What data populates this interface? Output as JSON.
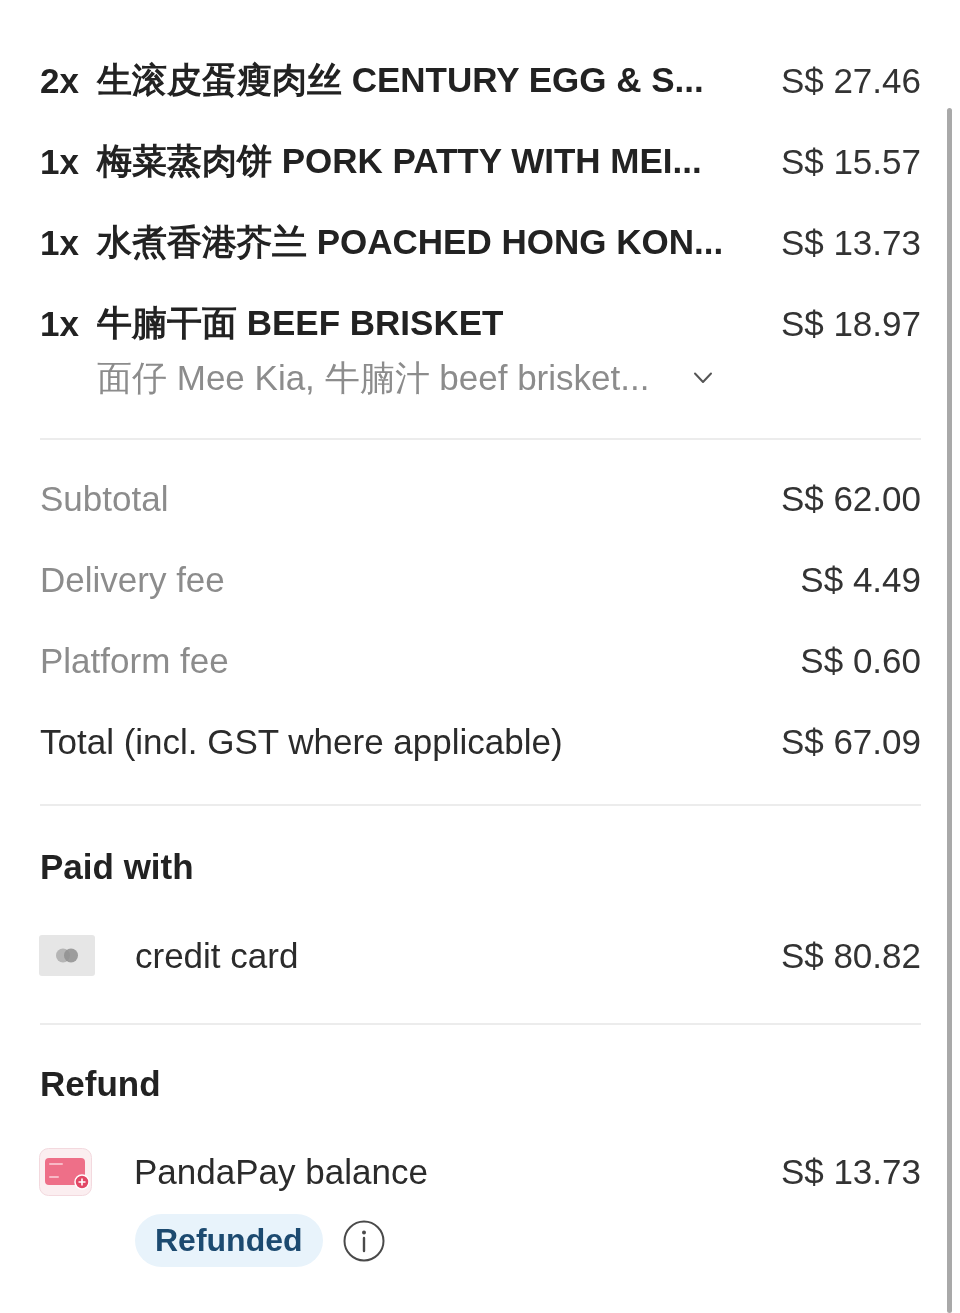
{
  "items": [
    {
      "quantity": "2x",
      "name": "生滚皮蛋瘦肉丝 CENTURY EGG & S...",
      "price": "S$ 27.46"
    },
    {
      "quantity": "1x",
      "name": "梅菜蒸肉饼 PORK PATTY WITH MEI...",
      "price": "S$ 15.57"
    },
    {
      "quantity": "1x",
      "name": "水煮香港芥兰 POACHED HONG KON...",
      "price": "S$ 13.73"
    },
    {
      "quantity": "1x",
      "name": "牛腩干面 BEEF BRISKET",
      "price": "S$ 18.97",
      "options": "面仔 Mee Kia, 牛腩汁 beef brisket...",
      "expanded": false
    }
  ],
  "summary": [
    {
      "kind": "fee",
      "label": "Subtotal",
      "value": "S$ 62.00"
    },
    {
      "kind": "fee",
      "label": "Delivery fee",
      "value": "S$ 4.49"
    },
    {
      "kind": "fee",
      "label": "Platform fee",
      "value": "S$ 0.60"
    },
    {
      "kind": "total",
      "label": "Total (incl. GST where applicable)",
      "value": "S$ 67.09"
    }
  ],
  "paid_with": {
    "title": "Paid with",
    "methods": [
      {
        "kind": "card",
        "label": "credit card",
        "amount": "S$ 80.82"
      }
    ]
  },
  "refund": {
    "title": "Refund",
    "methods": [
      {
        "kind": "wallet",
        "label": "PandaPay balance",
        "amount": "S$ 13.73",
        "status": "Refunded"
      }
    ]
  }
}
